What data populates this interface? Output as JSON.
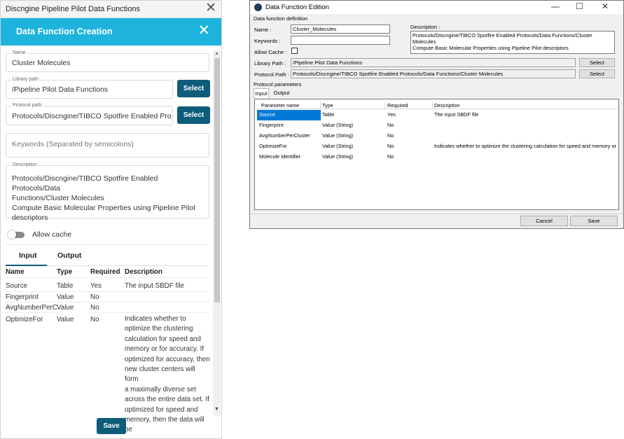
{
  "left_panel": {
    "window_title": "Discngine Pipeline Pilot Data Functions",
    "header_title": "Data Function Creation",
    "name": {
      "label": "Name",
      "value": "Cluster Molecules"
    },
    "library_path": {
      "label": "Library path",
      "value": "/Pipeline Pilot Data Functions",
      "button": "Select"
    },
    "protocol_path": {
      "label": "Protocol path",
      "value": "Protocols/Discngine/TIBCO Spotfire Enabled Protocol",
      "button": "Select"
    },
    "keywords": {
      "placeholder": "Keywords (Separated by semicolons)"
    },
    "description": {
      "label": "Description",
      "lines": [
        "Protocols/Discngine/TIBCO Spotfire Enabled Protocols/Data",
        "Functions/Cluster Molecules",
        "Compute Basic Molecular Properties using Pipeline Pilot",
        "descriptors"
      ]
    },
    "allow_cache_label": "Allow cache",
    "allow_cache_on": false,
    "tabs": [
      "Input",
      "Output"
    ],
    "active_tab": "Input",
    "table": {
      "headers": [
        "Name",
        "Type",
        "Required",
        "Description"
      ],
      "rows": [
        {
          "name": "Source",
          "type": "Table",
          "required": "Yes",
          "description": "The input SBDF file"
        },
        {
          "name": "Fingerprint",
          "type": "Value",
          "required": "No",
          "description": ""
        },
        {
          "name": "AvgNumberPerCluster",
          "type": "Value",
          "required": "No",
          "description": ""
        },
        {
          "name": "OptimizeFor",
          "type": "Value",
          "required": "No",
          "description": "Indicates whether to optimize the clustering calculation for speed and memory or for accuracy. If optimized for accuracy, then new cluster centers will form a maximally diverse set across the entire data set. If optimized for speed and memory, then the data will be"
        }
      ],
      "desc_wrapped": [
        "Indicates whether to",
        "optimize the clustering",
        "calculation for speed and",
        "memory or for accuracy. If",
        "optimized for accuracy, then",
        "new cluster centers will form",
        "a maximally diverse set",
        "across the entire data set. If",
        "optimized for speed and",
        "memory, then the data will be"
      ]
    },
    "save_label": "Save",
    "colors": {
      "header": "#1eb3dd",
      "button": "#0d5c7a"
    }
  },
  "right_dialog": {
    "window_title": "Data Function Edition",
    "group_label": "Data function definition",
    "name_label": "Name :",
    "name_value": "Cluster_Molecules",
    "keywords_label": "Keywords :",
    "keywords_value": "",
    "allow_cache_label": "Allow Cache :",
    "allow_cache_checked": false,
    "description_label": "Description :",
    "description_lines": [
      "Protocols/Discngine/TIBCO Spotfire Enabled Protocols/Data Functions/Cluster Molecules",
      "Compute Basic Molecular Properties using Pipeline Pilot descriptors"
    ],
    "library_path_label": "Library Path :",
    "library_path_value": "/Pipeline Pilot Data Functions",
    "protocol_path_label": "Protocol Path :",
    "protocol_path_value": "Protocols/Discngine/TIBCO Spotfire Enabled Protocols/Data Functions/Cluster Molecules",
    "select_label": "Select",
    "params_label": "Protocol parameters",
    "tabs": [
      "Input",
      "Output"
    ],
    "active_tab": "Input",
    "grid": {
      "headers": [
        "Parameter name",
        "Type",
        "Required",
        "Description"
      ],
      "rows": [
        {
          "name": "Source",
          "type": "Table",
          "required": "Yes",
          "description": "The input SBDF file",
          "selected": true
        },
        {
          "name": "Fingerprint",
          "type": "Value (String)",
          "required": "No",
          "description": ""
        },
        {
          "name": "AvgNumberPerCluster",
          "type": "Value (String)",
          "required": "No",
          "description": ""
        },
        {
          "name": "OptimizeFor",
          "type": "Value (String)",
          "required": "No",
          "description": "Indicates whether to optimize the clustering calculation for speed and memory or f..."
        },
        {
          "name": "Molecule Identifier",
          "type": "Value (String)",
          "required": "No",
          "description": ""
        }
      ]
    },
    "cancel_label": "Cancel",
    "save_label": "Save",
    "window_controls": {
      "minimize": "—",
      "maximize": "☐",
      "close": "✕"
    }
  }
}
